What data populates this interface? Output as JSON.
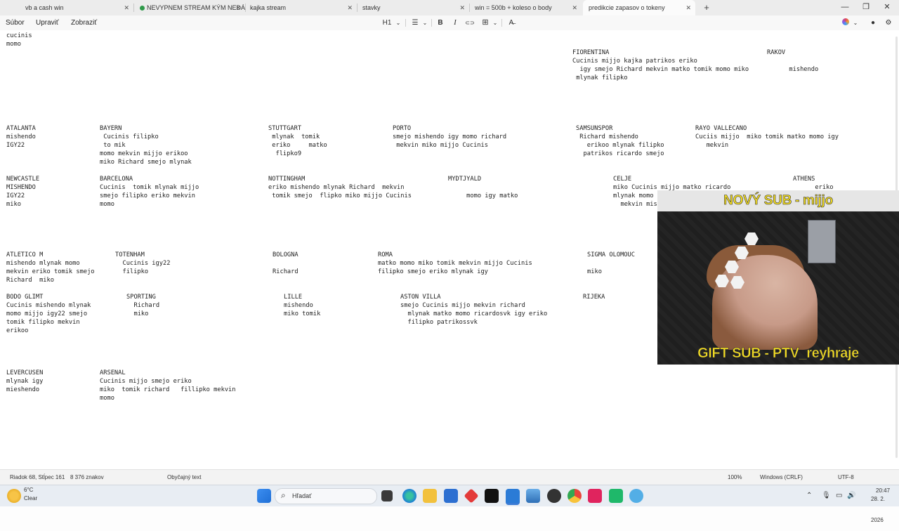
{
  "tabs": [
    {
      "label": "vb a cash  win"
    },
    {
      "label": "NEVYPNEM STREAM KÝM NEDÁI"
    },
    {
      "label": "kajka stream"
    },
    {
      "label": "stavky"
    },
    {
      "label": "win = 500b + koleso o body"
    },
    {
      "label": "predikcie zapasov o tokeny"
    }
  ],
  "window_controls": {
    "minimize": "—",
    "maximize": "❐",
    "close": "✕"
  },
  "menu": {
    "file": "Súbor",
    "edit": "Upraviť",
    "view": "Zobraziť"
  },
  "toolbar": {
    "heading": "H1",
    "bold": "B",
    "italic": "I",
    "link": "⊂⊃",
    "table": "⊞",
    "clear": "A̶"
  },
  "notes": {
    "n0": "cucinis\nmomo",
    "n1": "FIORENTINA\nCucinis mijjo kajka patrikos eriko\n  igy smejo Richard mekvin matko tomik momo miko\n mlynak filipko",
    "n2": "RAKOV\n\n      mishendo",
    "n3": "ATALANTA\nmishendo\nIGY22",
    "n4": "BAYERN\n Cucinis filipko\n to mik\nmomo mekvin mijjo erikoo\nmiko Richard smejo mlynak",
    "n5": "STUTTGART\n mlynak  tomik\n eriko     matko\n  flipko9",
    "n6": "PORTO\nsmejo mishendo igy momo richard\n mekvin miko mijjo Cucinis",
    "n7": "SAMSUNSPOR\n Richard mishendo\n   erikoo mlynak filipko\n  patrikos ricardo smejo",
    "n8": "RAYO VALLECANO\nCuciis mijjo  miko tomik matko momo igy\n   mekvin",
    "n9": "NEWCASTLE\nMISHENDO\nIGY22\nmiko",
    "n10": "BARCELONA\nCucinis  tomik mlynak mijjo\nsmejo filipko eriko mekvin\nmomo",
    "n11": "NOTTINGHAM\neriko mishendo mlynak Richard  mekvin\n tomik smejo  flipko miko mijjo Cucinis",
    "n12": "MYDTJYALD\n\n     momo igy matko",
    "n13": "CELJE\nmiko Cucinis mijjo matko ricardo\nmlynak momo\n  mekvin mish",
    "n14": "ATHENS\n      eriko",
    "n15": "ATLETICO M\nmishendo mlynak momo\nmekvin eriko tomik smejo\nRichard  miko",
    "n16": "TOTENHAM\n  Cucinis igy22\n  filipko",
    "n17": "BOLOGNA\n\nRichard",
    "n18": "ROMA\nmatko momo miko tomik mekvin mijjo Cucinis\nfilipko smejo eriko mlynak igy",
    "n19": "SIGMA OLOMOUC\n\nmiko",
    "n20": "BODO GLIMT\nCucinis mishendo mlynak\nmomo mijjo igy22 smejo\ntomik filipko mekvin\nerikoo",
    "n21": "SPORTING\n  Richard\n  miko",
    "n22": "LILLE\nmishendo\nmiko tomik",
    "n23": "ASTON VILLA\nsmejo Cucinis mijjo mekvin richard\n  mlynak matko momo ricardosvk igy eriko\n  filipko patrikossvk",
    "n24": "RIJEKA",
    "n25": "LEVERCUSEN\nmlynak igy\nmieshendo",
    "n26": "ARSENAL\nCucinis mijjo smejo eriko\nmiko  tomik richard   fillipko mekvin\nmomo"
  },
  "overlay": {
    "new_sub": "NOVÝ SUB - mijjo",
    "gift_sub": "GIFT SUB - PTV_reyhraje"
  },
  "status": {
    "position": "Riadok 68, Stĺpec 161",
    "chars": "8 376 znakov",
    "format": "Obyčajný text",
    "zoom": "100%",
    "eol": "Windows (CRLF)",
    "encoding": "UTF-8"
  },
  "taskbar": {
    "weather_temp": "6°C",
    "weather_desc": "Clear",
    "search_placeholder": "Hľadať",
    "time": "20:47",
    "date": "28. 2. 2026"
  }
}
